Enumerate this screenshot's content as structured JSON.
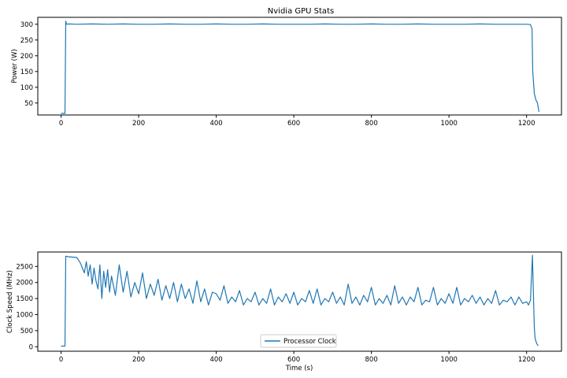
{
  "chart_data": [
    {
      "type": "line",
      "title": "Nvidia GPU Stats",
      "xlabel": "",
      "ylabel": "Power (W)",
      "xlim": [
        -60,
        1290
      ],
      "ylim": [
        12,
        322
      ],
      "xticks": [
        0,
        200,
        400,
        600,
        800,
        1000,
        1200
      ],
      "yticks": [
        50,
        100,
        150,
        200,
        250,
        300
      ],
      "color": "#1f77b4",
      "legend": false,
      "series": [
        {
          "x": [
            0,
            10,
            12,
            14,
            20,
            40,
            80,
            120,
            160,
            200,
            240,
            280,
            320,
            360,
            400,
            440,
            480,
            520,
            560,
            600,
            640,
            680,
            720,
            760,
            800,
            840,
            880,
            920,
            960,
            1000,
            1040,
            1080,
            1120,
            1160,
            1200,
            1210,
            1214,
            1216,
            1218,
            1220,
            1224,
            1228,
            1232
          ],
          "y": [
            17,
            17,
            310,
            300,
            301,
            300,
            301,
            300,
            301,
            300,
            300,
            301,
            300,
            300,
            301,
            300,
            300,
            301,
            300,
            300,
            300,
            301,
            300,
            300,
            301,
            300,
            300,
            301,
            300,
            300,
            300,
            301,
            300,
            300,
            300,
            299,
            285,
            150,
            115,
            80,
            60,
            50,
            22
          ]
        }
      ]
    },
    {
      "type": "line",
      "title": "",
      "xlabel": "Time (s)",
      "ylabel": "Clock Speed (MHz)",
      "xlim": [
        -60,
        1290
      ],
      "ylim": [
        -140,
        2950
      ],
      "xticks": [
        0,
        200,
        400,
        600,
        800,
        1000,
        1200
      ],
      "yticks": [
        0,
        500,
        1000,
        1500,
        2000,
        2500
      ],
      "color": "#1f77b4",
      "legend": true,
      "legend_loc": "lower center",
      "series": [
        {
          "name": "Processor Clock",
          "x": [
            0,
            10,
            12,
            20,
            30,
            40,
            45,
            50,
            55,
            60,
            65,
            70,
            75,
            80,
            85,
            90,
            95,
            100,
            105,
            110,
            115,
            120,
            125,
            130,
            140,
            150,
            160,
            170,
            180,
            190,
            200,
            210,
            220,
            230,
            240,
            250,
            260,
            270,
            280,
            290,
            300,
            310,
            320,
            330,
            340,
            350,
            360,
            370,
            380,
            390,
            400,
            410,
            420,
            430,
            440,
            450,
            460,
            470,
            480,
            490,
            500,
            510,
            520,
            530,
            540,
            550,
            560,
            570,
            580,
            590,
            600,
            610,
            620,
            630,
            640,
            650,
            660,
            670,
            680,
            690,
            700,
            710,
            720,
            730,
            740,
            750,
            760,
            770,
            780,
            790,
            800,
            810,
            820,
            830,
            840,
            850,
            860,
            870,
            880,
            890,
            900,
            910,
            920,
            930,
            940,
            950,
            960,
            970,
            980,
            990,
            1000,
            1010,
            1020,
            1030,
            1040,
            1050,
            1060,
            1070,
            1080,
            1090,
            1100,
            1110,
            1120,
            1130,
            1140,
            1150,
            1160,
            1170,
            1180,
            1190,
            1200,
            1205,
            1210,
            1215,
            1218,
            1220,
            1222,
            1226,
            1230
          ],
          "y": [
            20,
            20,
            2820,
            2800,
            2790,
            2780,
            2700,
            2600,
            2450,
            2300,
            2650,
            2200,
            2550,
            1950,
            2450,
            2050,
            1800,
            2550,
            1500,
            2350,
            1850,
            2400,
            1700,
            2200,
            1600,
            2550,
            1700,
            2350,
            1550,
            2000,
            1650,
            2300,
            1500,
            1950,
            1600,
            2100,
            1450,
            1900,
            1500,
            2000,
            1400,
            1950,
            1500,
            1800,
            1350,
            2050,
            1400,
            1800,
            1300,
            1700,
            1650,
            1450,
            1900,
            1350,
            1550,
            1400,
            1750,
            1300,
            1500,
            1400,
            1700,
            1300,
            1500,
            1350,
            1800,
            1300,
            1550,
            1400,
            1650,
            1350,
            1700,
            1300,
            1500,
            1400,
            1750,
            1350,
            1800,
            1300,
            1500,
            1400,
            1700,
            1350,
            1550,
            1300,
            1950,
            1350,
            1550,
            1300,
            1600,
            1400,
            1850,
            1300,
            1500,
            1350,
            1600,
            1300,
            1900,
            1350,
            1550,
            1300,
            1550,
            1400,
            1850,
            1300,
            1450,
            1400,
            1850,
            1300,
            1500,
            1350,
            1650,
            1350,
            1850,
            1300,
            1500,
            1400,
            1600,
            1350,
            1550,
            1300,
            1500,
            1350,
            1750,
            1300,
            1450,
            1400,
            1550,
            1300,
            1550,
            1350,
            1400,
            1300,
            1450,
            2850,
            1500,
            600,
            250,
            100,
            30
          ]
        }
      ]
    }
  ]
}
